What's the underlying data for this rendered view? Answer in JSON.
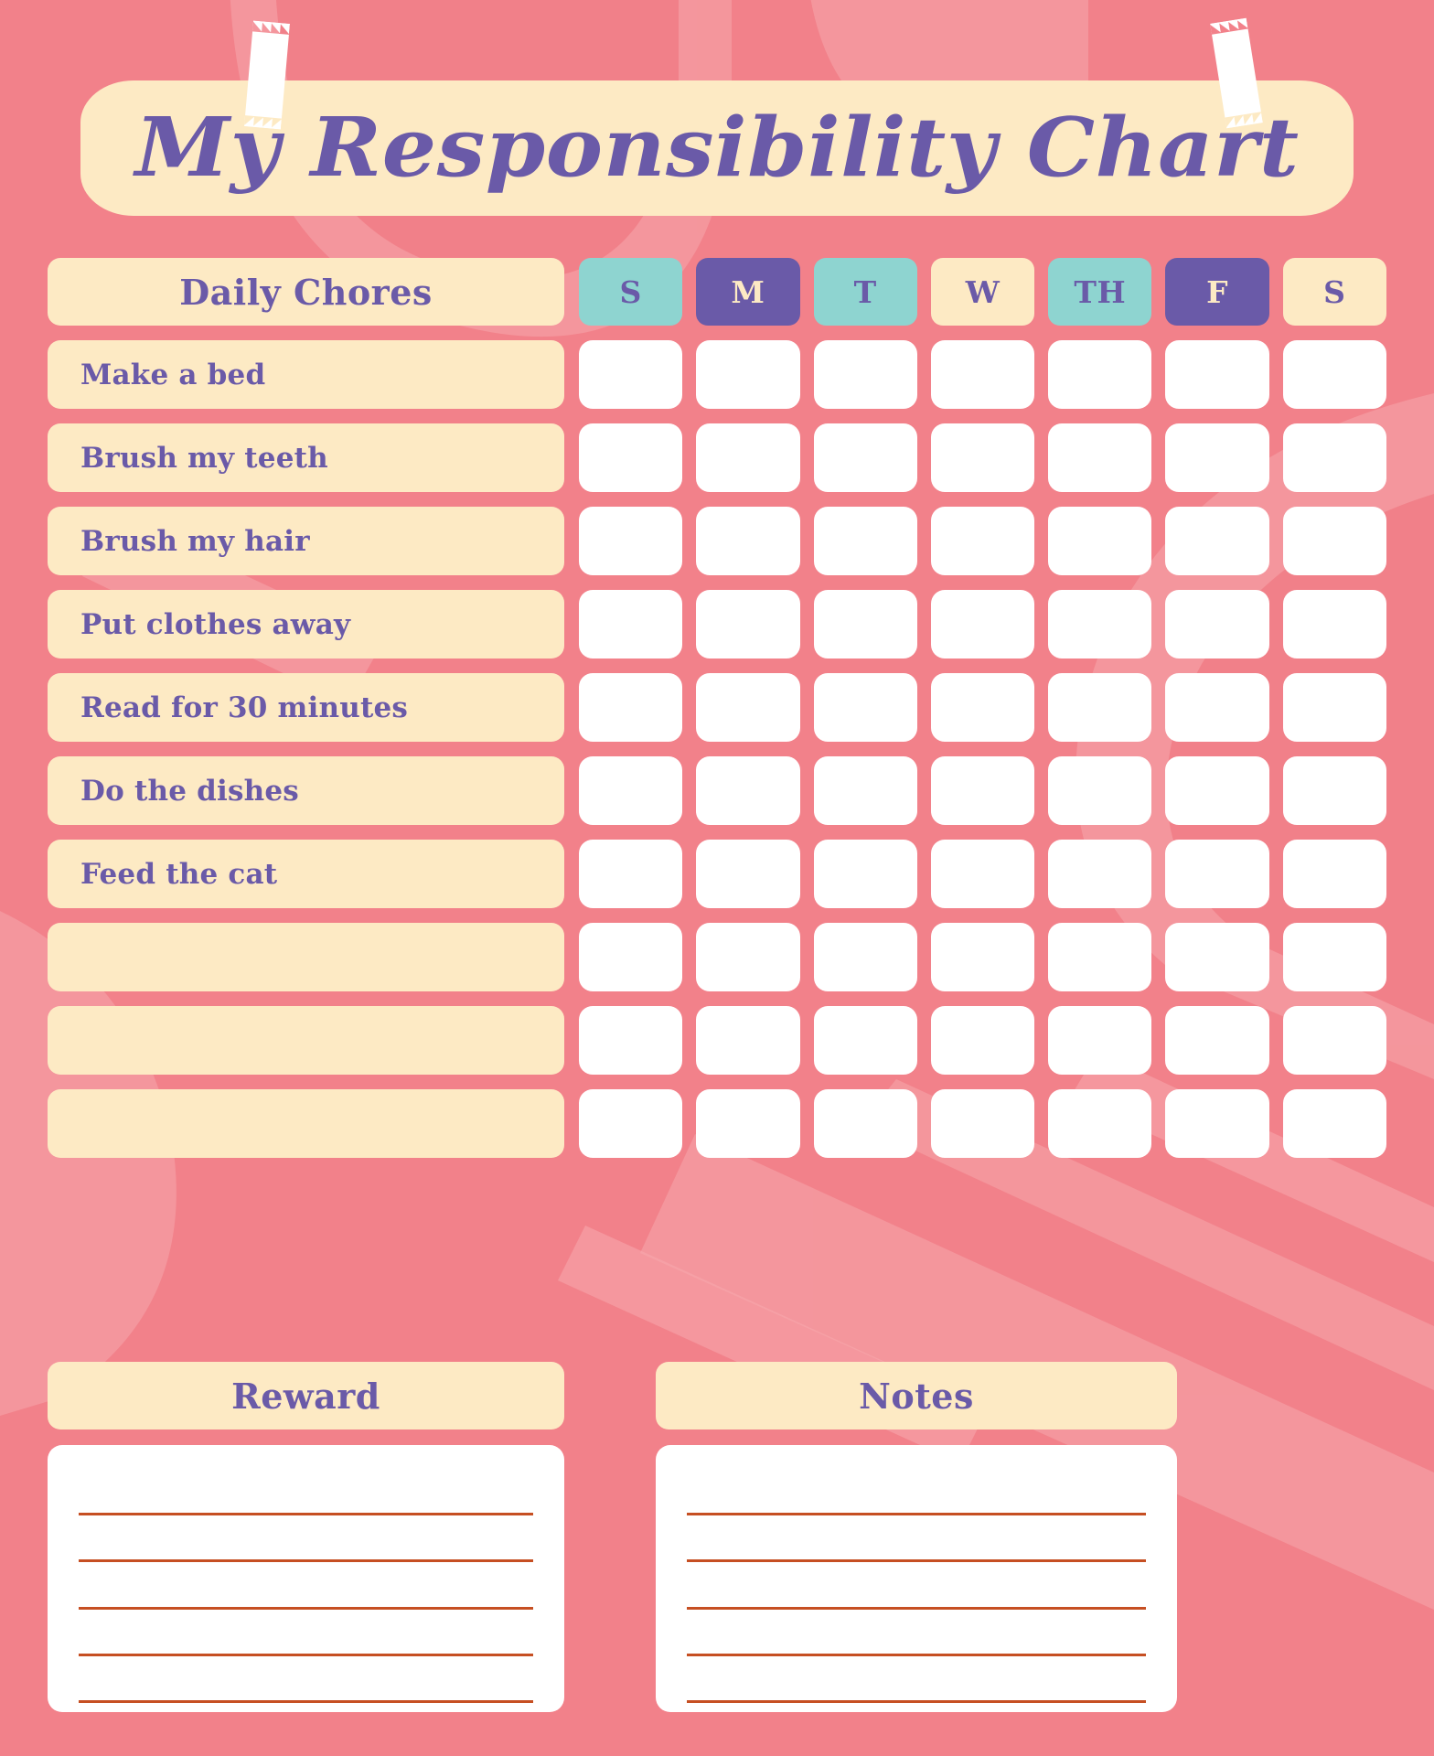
{
  "theme": {
    "background": "#f2818a",
    "cream": "#fdeac4",
    "purple": "#6a5aa8",
    "teal": "#8ed4d0",
    "white": "#ffffff",
    "rule_line": "#c64f22"
  },
  "banner": {
    "title": "My Responsibility Chart",
    "tape_left": "tape-strip",
    "tape_right": "tape-strip"
  },
  "table": {
    "header": {
      "label": "Daily Chores",
      "days": [
        {
          "label": "S",
          "style": "day-teal"
        },
        {
          "label": "M",
          "style": "day-purple"
        },
        {
          "label": "T",
          "style": "day-teal"
        },
        {
          "label": "W",
          "style": "day-cream"
        },
        {
          "label": "TH",
          "style": "day-teal"
        },
        {
          "label": "F",
          "style": "day-purple"
        },
        {
          "label": "S",
          "style": "day-cream"
        }
      ]
    },
    "rows": [
      {
        "label": "Make a bed"
      },
      {
        "label": "Brush my teeth"
      },
      {
        "label": "Brush my hair"
      },
      {
        "label": "Put clothes away"
      },
      {
        "label": "Read for 30 minutes"
      },
      {
        "label": "Do the dishes"
      },
      {
        "label": "Feed the cat"
      },
      {
        "label": ""
      },
      {
        "label": ""
      },
      {
        "label": ""
      }
    ],
    "checkbox_columns": 7
  },
  "bottom": {
    "reward": {
      "title": "Reward",
      "lines": 5
    },
    "notes": {
      "title": "Notes",
      "lines": 5
    }
  }
}
